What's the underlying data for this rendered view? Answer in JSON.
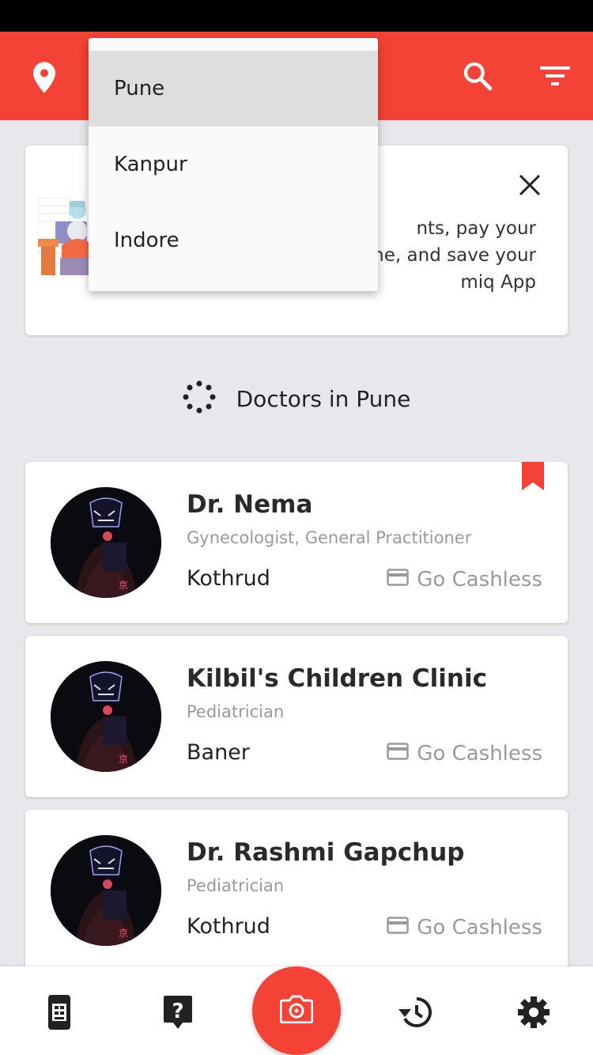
{
  "app": {
    "accent_color": "#f44336",
    "icons": {
      "location": "location-pin-icon",
      "search": "search-icon",
      "filter": "filter-icon"
    }
  },
  "city_dropdown": {
    "selected": "Pune",
    "options": [
      "Pune",
      "Kanpur",
      "Indore"
    ]
  },
  "banner": {
    "text": "nts, pay your\nine, and save your\nmiq App"
  },
  "section": {
    "title": "Doctors in Pune"
  },
  "doctors": [
    {
      "name": "Dr. Nema",
      "specialty": "Gynecologist, General Practitioner",
      "area": "Kothrud",
      "payment": "Go Cashless",
      "bookmarked": true
    },
    {
      "name": "Kilbil's Children Clinic",
      "specialty": "Pediatrician",
      "area": "Baner",
      "payment": "Go Cashless",
      "bookmarked": false
    },
    {
      "name": "Dr. Rashmi Gapchup",
      "specialty": "Pediatrician",
      "area": "Kothrud",
      "payment": "Go Cashless",
      "bookmarked": false
    }
  ],
  "bottom_nav": {
    "items": [
      "card-icon",
      "help-icon",
      "camera-icon",
      "history-icon",
      "settings-icon"
    ]
  }
}
